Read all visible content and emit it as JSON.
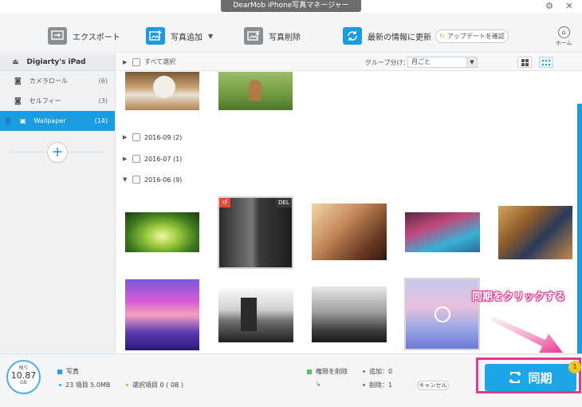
{
  "window": {
    "title": "DearMob iPhone写真マネージャー",
    "settings_icon": "gear-icon",
    "close_icon": "close-icon"
  },
  "toolbar": {
    "export_label": "エクスポート",
    "add_photo_label": "写真追加",
    "delete_photo_label": "写真削除",
    "refresh_label": "最新の情報に更新",
    "update_check_label": "アップデートを確認",
    "home_label": "ホーム"
  },
  "sidebar": {
    "device_name": "Digiarty's iPad",
    "items": [
      {
        "label": "カメラロール",
        "count": "(6)"
      },
      {
        "label": "セルフィー",
        "count": "(3)"
      },
      {
        "label": "Wallpaper",
        "count": "(14)",
        "active": true
      }
    ]
  },
  "filter": {
    "select_all_label": "すべて選択",
    "group_label": "グループ分け：",
    "group_value": "月ごと"
  },
  "sections": [
    {
      "label": "2016-09 (2)",
      "expanded": false
    },
    {
      "label": "2016-07 (1)",
      "expanded": false
    },
    {
      "label": "2016-06 (9)",
      "expanded": true
    }
  ],
  "badges": {
    "undo": "↺",
    "delete": "DEL"
  },
  "bottom": {
    "remaining_label": "残り",
    "remaining_value": "10.87",
    "remaining_unit": "GB",
    "photos_label": "写真",
    "photos_detail": "23 項目 5.0MB",
    "selected_label": "選択項目 0 ( 0B )",
    "perm_delete_label": "権限を削除",
    "added_label": "追加：0",
    "removed_label": "削除：1",
    "cancel_label": "キャンセル",
    "sync_label": "同期",
    "sync_badge": "1",
    "callout_text": "同期をクリックする"
  },
  "colors": {
    "accent": "#1b9be0",
    "highlight": "#e6388f",
    "badge": "#f5c518"
  }
}
